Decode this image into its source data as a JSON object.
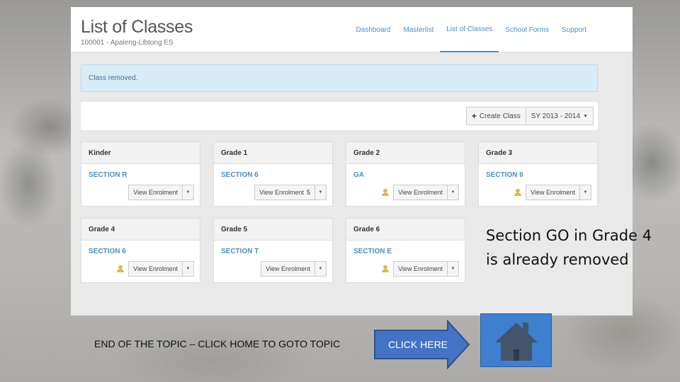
{
  "app": {
    "title": "List of Classes",
    "school": "100001 - Apaleng-Libtong ES"
  },
  "nav": {
    "items": [
      "Dashboard",
      "Masterlist",
      "List of Classes",
      "School Forms",
      "Support"
    ],
    "active": "List of Classes"
  },
  "alert": {
    "text": "Class removed."
  },
  "toolbar": {
    "create_label": "Create Class",
    "school_year": "SY 2013 - 2014"
  },
  "cards": [
    {
      "grade": "Kinder",
      "section": "SECTION R",
      "button": "View Enrolment",
      "badge": "",
      "has_adviser_icon": false
    },
    {
      "grade": "Grade 1",
      "section": "SECTION 6",
      "button": "View Enrolment",
      "badge": "5",
      "has_adviser_icon": false
    },
    {
      "grade": "Grade 2",
      "section": "GA",
      "button": "View Enrolment",
      "badge": "",
      "has_adviser_icon": true
    },
    {
      "grade": "Grade 3",
      "section": "SECTION 6",
      "button": "View Enrolment",
      "badge": "",
      "has_adviser_icon": true
    },
    {
      "grade": "Grade 4",
      "section": "SECTION 6",
      "button": "View Enrolment",
      "badge": "",
      "has_adviser_icon": true
    },
    {
      "grade": "Grade 5",
      "section": "SECTION T",
      "button": "View Enrolment",
      "badge": "",
      "has_adviser_icon": false
    },
    {
      "grade": "Grade 6",
      "section": "SECTION E",
      "button": "View Enrolment",
      "badge": "",
      "has_adviser_icon": true
    }
  ],
  "slide": {
    "annotation": "Section GO in Grade 4 is already removed",
    "footer": "END OF THE TOPIC – CLICK HOME TO GOTO TOPIC",
    "click_here": "CLICK HERE"
  },
  "colors": {
    "link": "#4a8fc6",
    "alert_bg": "#d8ecf8",
    "button_blue": "#4472c4",
    "home_blue": "#3e7fcf"
  },
  "icons": {
    "adviser": "user-icon",
    "create": "plus-icon",
    "home": "home-icon",
    "arrow": "right-arrow-icon"
  }
}
